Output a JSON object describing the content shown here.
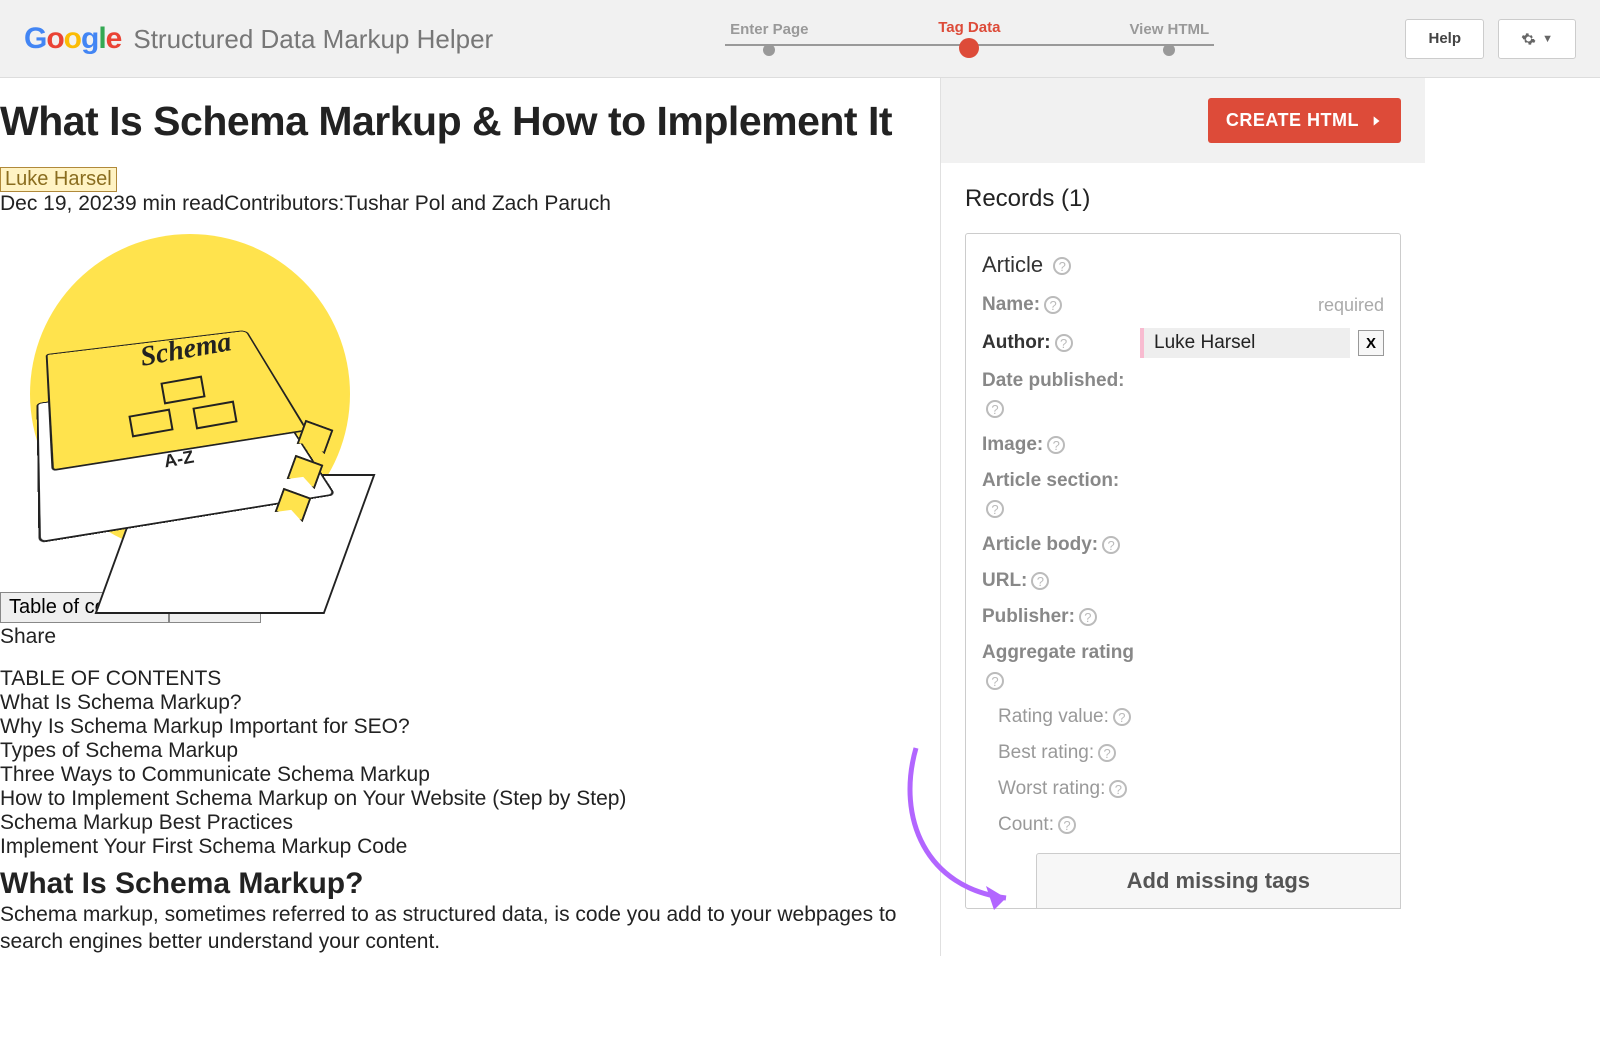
{
  "header": {
    "app_title": "Structured Data Markup Helper",
    "steps": [
      "Enter Page",
      "Tag Data",
      "View HTML"
    ],
    "active_step": 1,
    "help": "Help"
  },
  "article": {
    "title": "What Is Schema Markup & How to Implement It",
    "author": "Luke Harsel",
    "date": "Dec 19, 2023",
    "read_time": "9 min read",
    "contributors_label": "Contributors:",
    "contributors": "Tushar Pol and Zach Paruch",
    "illustration": {
      "cover_text": "Schema",
      "az": "A-Z"
    },
    "toc_button": "Table of contents",
    "share_button": "Share",
    "share_label": "Share",
    "toc_heading": "TABLE OF CONTENTS",
    "toc": [
      "What Is Schema Markup?",
      "Why Is Schema Markup Important for SEO?",
      "Types of Schema Markup",
      "Three Ways to Communicate Schema Markup",
      "How to Implement Schema Markup on Your Website (Step by Step)",
      "Schema Markup Best Practices",
      "Implement Your First Schema Markup Code"
    ],
    "section_heading": "What Is Schema Markup?",
    "body": "Schema markup, sometimes referred to as structured data, is code you add to your webpages to search engines better understand your content."
  },
  "panel": {
    "create_html": "CREATE HTML",
    "records_title": "Records (1)",
    "record_type": "Article",
    "fields": {
      "name": {
        "label": "Name:",
        "required": "required"
      },
      "author": {
        "label": "Author:",
        "value": "Luke Harsel"
      },
      "date_published": {
        "label": "Date published:"
      },
      "image": {
        "label": "Image:"
      },
      "article_section": {
        "label": "Article section:"
      },
      "article_body": {
        "label": "Article body:"
      },
      "url": {
        "label": "URL:"
      },
      "publisher": {
        "label": "Publisher:"
      },
      "aggregate": {
        "label": "Aggregate rating"
      },
      "rating_value": {
        "label": "Rating value:"
      },
      "best_rating": {
        "label": "Best rating:"
      },
      "worst_rating": {
        "label": "Worst rating:"
      },
      "count": {
        "label": "Count:"
      }
    },
    "add_missing": "Add missing tags"
  }
}
